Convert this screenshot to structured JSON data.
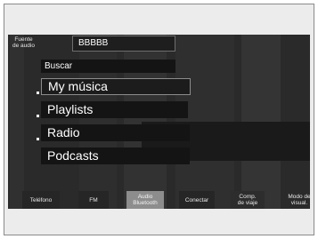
{
  "header": {
    "source_label_line1": "Fuente",
    "source_label_line2": "de audio",
    "source_value": "BBBBB"
  },
  "menu": {
    "items": [
      {
        "label": "Buscar"
      },
      {
        "label": "My música"
      },
      {
        "label": "Playlists"
      },
      {
        "label": "Radio"
      },
      {
        "label": "Podcasts"
      }
    ],
    "selected": "My música"
  },
  "bottom_bar": {
    "buttons": [
      {
        "line1": "Teléfono",
        "line2": ""
      },
      {
        "line1": "FM",
        "line2": ""
      },
      {
        "line1": "Audio",
        "line2": "Bluetooth"
      },
      {
        "line1": "Conectar",
        "line2": ""
      },
      {
        "line1": "Comp.",
        "line2": "de viaje"
      },
      {
        "line1": "Modo de",
        "line2": "visual."
      }
    ],
    "active": "Audio Bluetooth"
  },
  "colors": {
    "screen_background": "#2a2a2a",
    "menu_item_background": "#141414",
    "active_button": "#8d8d8d",
    "text": "#ffffff"
  }
}
